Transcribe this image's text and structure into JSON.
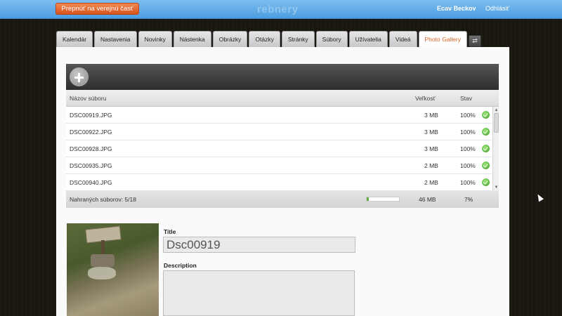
{
  "topbar": {
    "public_button": "Prepnúť na verejnú časť",
    "logo": "rebnery",
    "user_name": "Ecav Beckov",
    "logout": "Odhlásiť"
  },
  "tabs": [
    {
      "label": "Kalendár"
    },
    {
      "label": "Nastavenia"
    },
    {
      "label": "Novinky"
    },
    {
      "label": "Nástenka"
    },
    {
      "label": "Obrázky"
    },
    {
      "label": "Otázky"
    },
    {
      "label": "Stránky"
    },
    {
      "label": "Súbory"
    },
    {
      "label": "Užívatelia"
    },
    {
      "label": "Videá"
    },
    {
      "label": "Photo Gallery",
      "active": true
    }
  ],
  "tab_extra_icon": "shuffle-icon",
  "file_table": {
    "headers": {
      "name": "Názov súboru",
      "size": "Veľkosť",
      "status": "Stav"
    },
    "rows": [
      {
        "name": "DSC00919.JPG",
        "size": "3 MB",
        "status": "100%"
      },
      {
        "name": "DSC00922.JPG",
        "size": "3 MB",
        "status": "100%"
      },
      {
        "name": "DSC00928.JPG",
        "size": "3 MB",
        "status": "100%"
      },
      {
        "name": "DSC00935.JPG",
        "size": "2 MB",
        "status": "100%"
      },
      {
        "name": "DSC00940.JPG",
        "size": "2 MB",
        "status": "100%"
      }
    ],
    "footer": {
      "uploaded": "Nahraných súborov: 5/18",
      "total_size": "46 MB",
      "percent": "7%",
      "progress_fraction": 0.07
    }
  },
  "detail": {
    "title_label": "Title",
    "title_value": "Dsc00919",
    "description_label": "Description",
    "description_value": ""
  },
  "colors": {
    "accent": "#d9642a",
    "topbar": "#4d9ee0",
    "ok": "#3ea52b"
  }
}
